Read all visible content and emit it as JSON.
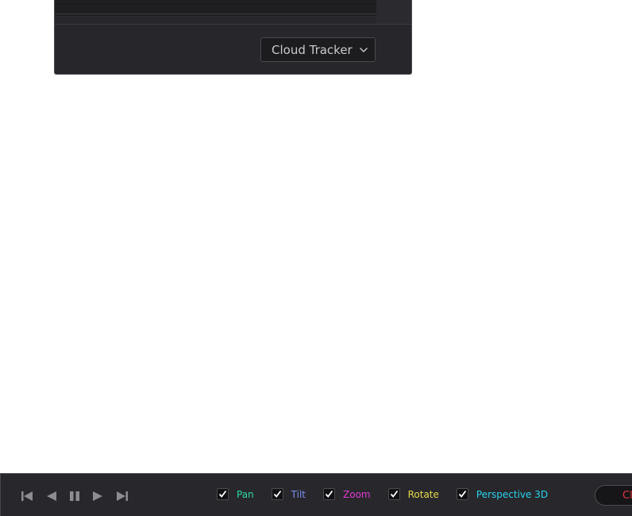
{
  "tracker_panel": {
    "mode_select": {
      "value": "Cloud Tracker",
      "icon": "chevron-down-icon"
    }
  },
  "bottom_toolbar": {
    "transport": [
      {
        "name": "go-to-start",
        "icon": "skip-to-start-icon"
      },
      {
        "name": "play-reverse",
        "icon": "play-reverse-icon"
      },
      {
        "name": "pause",
        "icon": "pause-icon"
      },
      {
        "name": "play-forward",
        "icon": "play-forward-icon"
      },
      {
        "name": "go-to-end",
        "icon": "skip-to-end-icon"
      }
    ],
    "track_options": [
      {
        "label": "Pan",
        "checked": true,
        "color": "#2ed8a4"
      },
      {
        "label": "Tilt",
        "checked": true,
        "color": "#7b8df0"
      },
      {
        "label": "Zoom",
        "checked": true,
        "color": "#e33ad8"
      },
      {
        "label": "Rotate",
        "checked": true,
        "color": "#e6d84a"
      },
      {
        "label": "Perspective 3D",
        "checked": true,
        "color": "#27d2ee"
      }
    ],
    "clear_button": {
      "label": "Cl",
      "color": "#e2353a"
    }
  }
}
